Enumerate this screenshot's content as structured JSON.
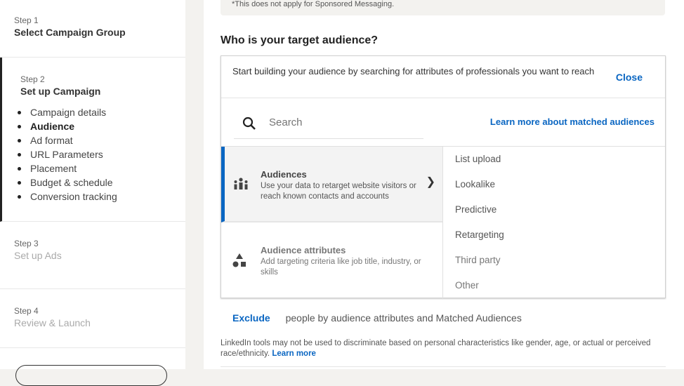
{
  "sidebar": {
    "steps": [
      {
        "num": "Step 1",
        "title": "Select Campaign Group"
      },
      {
        "num": "Step 2",
        "title": "Set up Campaign",
        "items": [
          "Campaign details",
          "Audience",
          "Ad format",
          "URL Parameters",
          "Placement",
          "Budget & schedule",
          "Conversion tracking"
        ],
        "active_item": "Audience"
      },
      {
        "num": "Step 3",
        "title": "Set up Ads"
      },
      {
        "num": "Step 4",
        "title": "Review & Launch"
      }
    ]
  },
  "main": {
    "note": "*This does not apply for Sponsored Messaging.",
    "question": "Who is your target audience?",
    "panel": {
      "intro": "Start building your audience by searching for attributes of professionals you want to reach",
      "close": "Close",
      "search_placeholder": "Search",
      "learn_matched": "Learn more about matched audiences",
      "categories": [
        {
          "title": "Audiences",
          "desc": "Use your data to retarget website visitors or reach known contacts and accounts",
          "icon": "people-icon",
          "selected": true
        },
        {
          "title": "Audience attributes",
          "desc": "Add targeting criteria like job title, industry, or skills",
          "icon": "shapes-icon",
          "selected": false
        }
      ],
      "subitems": [
        "List upload",
        "Lookalike",
        "Predictive",
        "Retargeting",
        "Third party",
        "Other"
      ]
    },
    "exclude": {
      "link": "Exclude",
      "text": "people by audience attributes and Matched Audiences"
    },
    "disclaimer": {
      "text": "LinkedIn tools may not be used to discriminate based on personal characteristics like gender, age, or actual or perceived race/ethnicity.",
      "link": "Learn more"
    },
    "accent": "#0a66c2"
  }
}
